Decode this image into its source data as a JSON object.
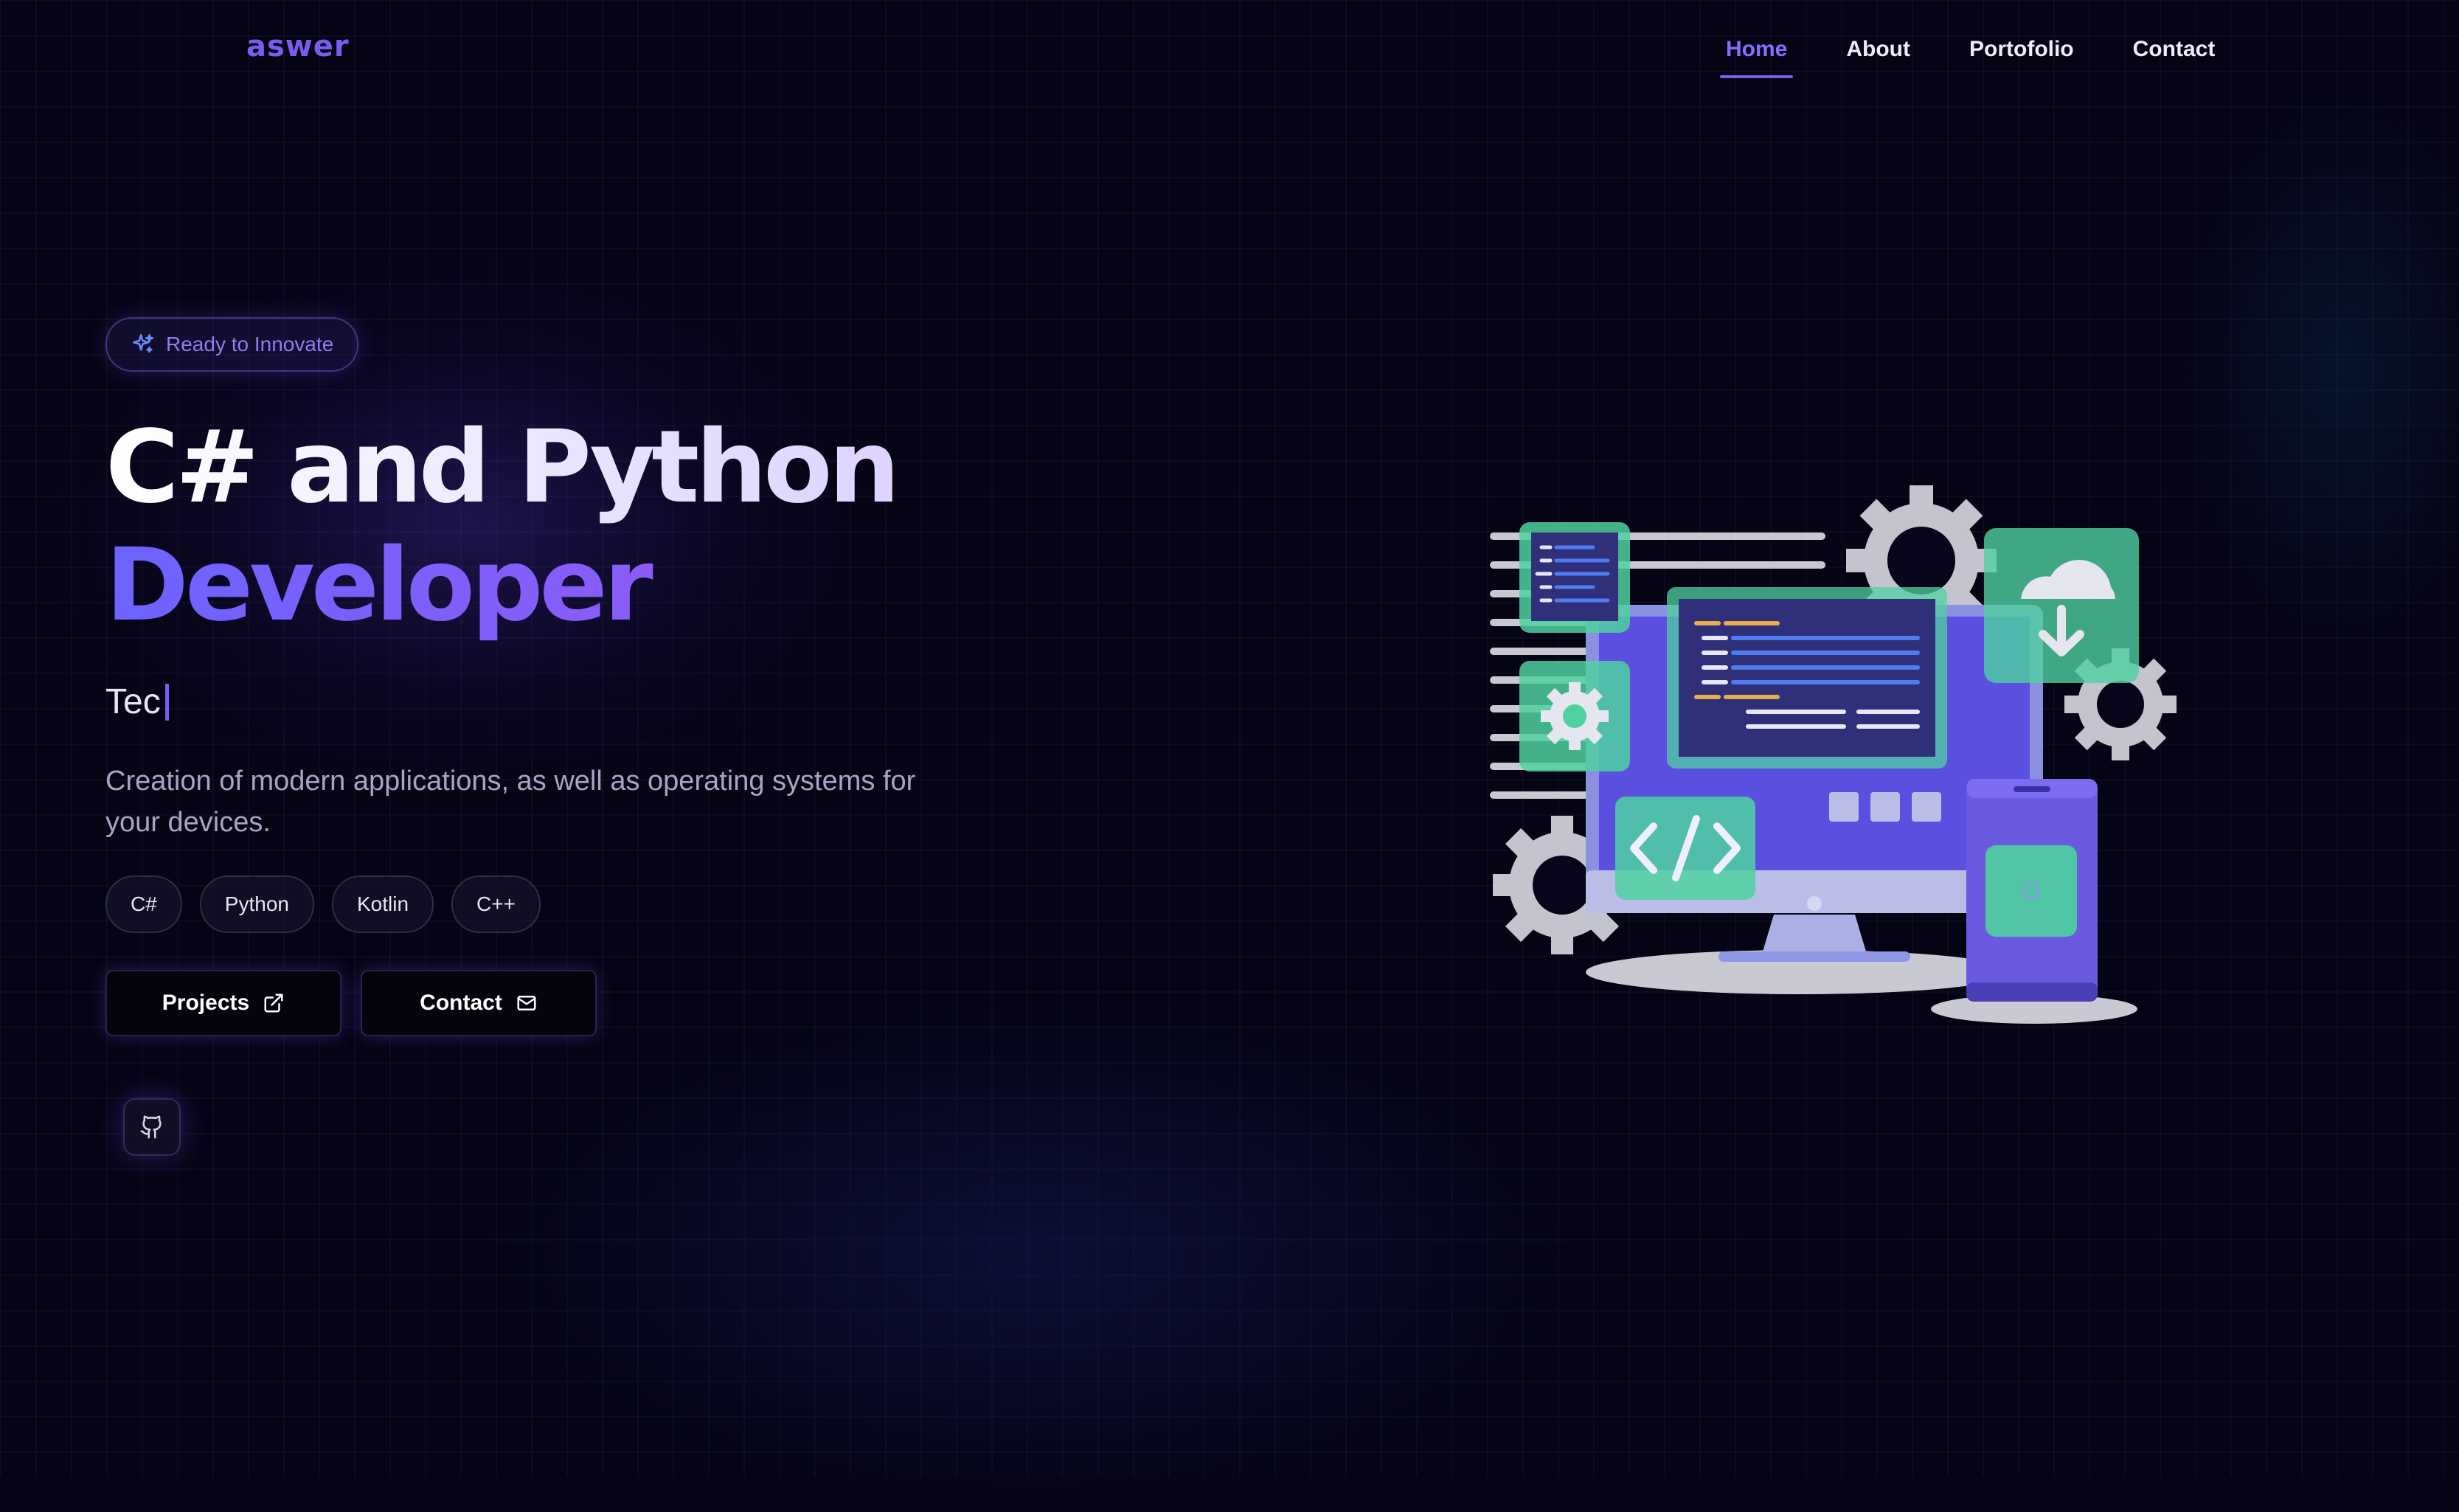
{
  "brand": {
    "logo": "aswer",
    "accent": "#7b5cf0"
  },
  "nav": {
    "links": [
      {
        "label": "Home",
        "active": true
      },
      {
        "label": "About",
        "active": false
      },
      {
        "label": "Portofolio",
        "active": false
      },
      {
        "label": "Contact",
        "active": false
      }
    ]
  },
  "hero": {
    "badge": {
      "icon": "sparkles-icon",
      "text": "Ready to Innovate"
    },
    "title_line1": "C# and Python",
    "title_line2": "Developer",
    "typing_text": "Tec",
    "description": "Creation of modern applications, as well as operating systems for your devices.",
    "tags": [
      "C#",
      "Python",
      "Kotlin",
      "C++"
    ],
    "buttons": {
      "projects": {
        "label": "Projects",
        "icon": "external-link-icon"
      },
      "contact": {
        "label": "Contact",
        "icon": "mail-icon"
      }
    },
    "social": {
      "github_icon": "github-icon"
    }
  },
  "illustration": {
    "name": "developer-workstation-illustration"
  },
  "colors": {
    "background": "#050414",
    "accent": "#7b5cf0",
    "title_gradient_start": "#6c63ff",
    "title_gradient_end": "#a855f7"
  }
}
